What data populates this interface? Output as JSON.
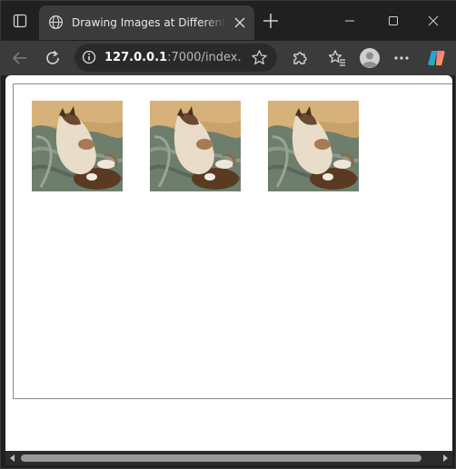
{
  "tab": {
    "title": "Drawing Images at Different Coordinates"
  },
  "address": {
    "host": "127.0.0.1",
    "rest": ":7000/index.h..."
  },
  "page": {
    "images": [
      {
        "alt": "cat lying on a green knitted blanket"
      },
      {
        "alt": "cat lying on a green knitted blanket"
      },
      {
        "alt": "cat lying on a green knitted blanket"
      }
    ]
  },
  "colors": {
    "chrome_bg": "#202020",
    "toolbar_bg": "#3b3b3b",
    "page_bg": "#ffffff",
    "canvas_border": "#8a8a8a"
  },
  "icons": {
    "tab_actions": "tab-actions-icon",
    "favicon": "globe-icon",
    "close": "close-icon",
    "new_tab": "plus-icon",
    "back": "back-arrow-icon",
    "reload": "reload-icon",
    "info": "info-icon",
    "star": "star-icon",
    "extensions": "puzzle-icon",
    "favorites": "favorites-icon",
    "profile": "profile-icon",
    "more": "more-icon",
    "copilot": "copilot-icon"
  }
}
